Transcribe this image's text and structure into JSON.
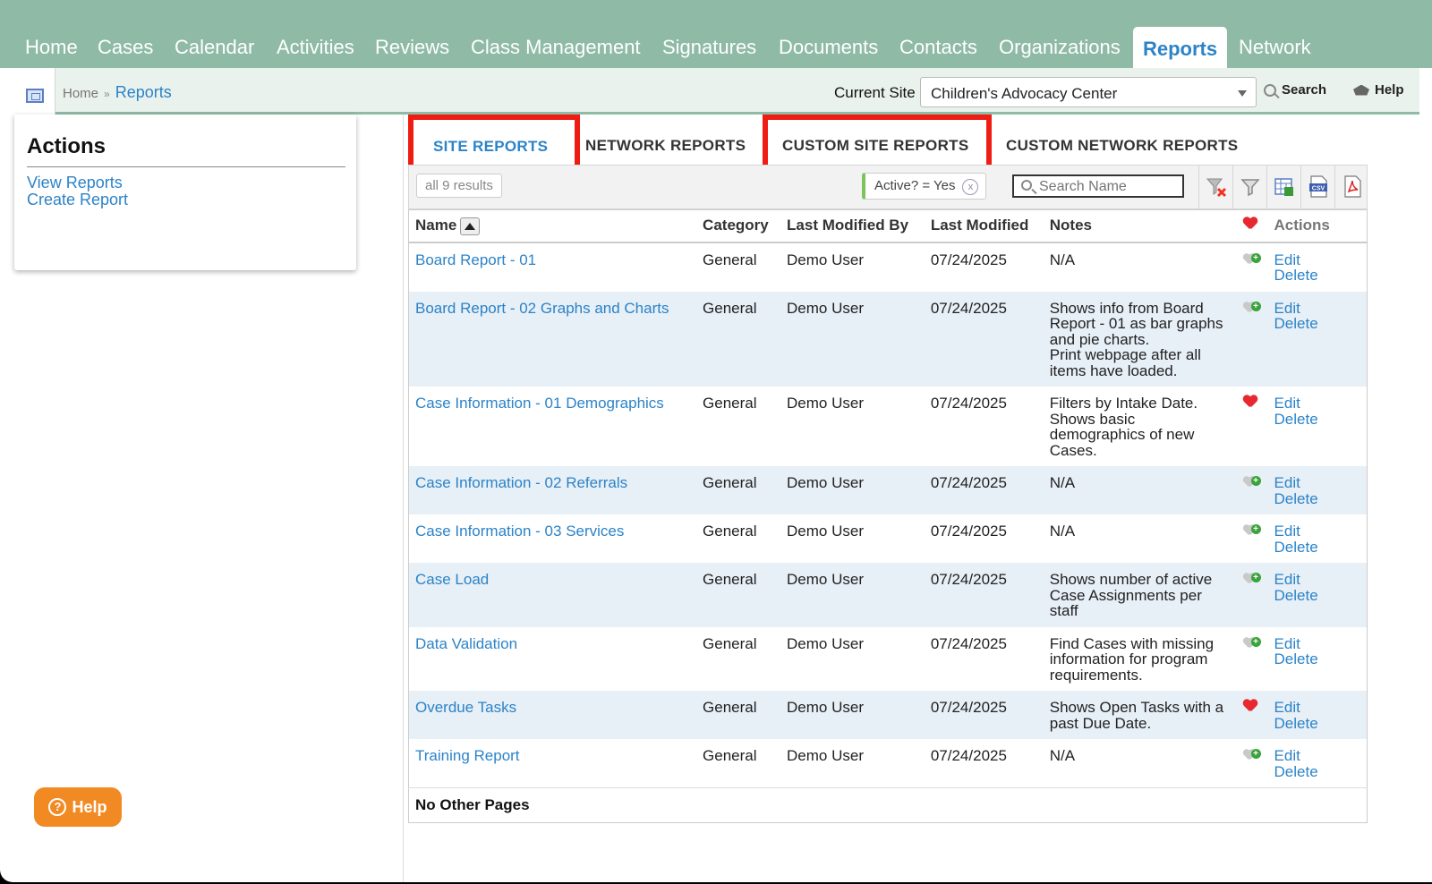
{
  "nav": {
    "items": [
      {
        "label": "Home"
      },
      {
        "label": "Cases"
      },
      {
        "label": "Calendar"
      },
      {
        "label": "Activities"
      },
      {
        "label": "Reviews"
      },
      {
        "label": "Class Management"
      },
      {
        "label": "Signatures"
      },
      {
        "label": "Documents"
      },
      {
        "label": "Contacts"
      },
      {
        "label": "Organizations"
      },
      {
        "label": "Reports",
        "active": true
      },
      {
        "label": "Network"
      }
    ]
  },
  "breadcrumb": {
    "home": "Home",
    "separator": "»",
    "current": "Reports"
  },
  "site": {
    "label": "Current Site",
    "value": "Children's Advocacy Center"
  },
  "tools": {
    "search": "Search",
    "help": "Help"
  },
  "actions": {
    "title": "Actions",
    "links": [
      "View Reports",
      "Create Report"
    ]
  },
  "tabs": [
    {
      "label": "SITE REPORTS",
      "active": true,
      "highlighted": true
    },
    {
      "label": "NETWORK REPORTS"
    },
    {
      "label": "CUSTOM SITE REPORTS",
      "highlighted": true
    },
    {
      "label": "CUSTOM NETWORK REPORTS"
    }
  ],
  "toolbar": {
    "results": "all 9 results",
    "filter": "Active? = Yes",
    "filter_clear": "x",
    "search_placeholder": "Search Name",
    "icons": [
      "clear-filters-icon",
      "filter-icon",
      "excel-export-icon",
      "csv-export-icon",
      "pdf-export-icon"
    ]
  },
  "table": {
    "headers": {
      "name": "Name",
      "category": "Category",
      "modified_by": "Last Modified By",
      "modified": "Last Modified",
      "notes": "Notes",
      "favorite": "favorite-heart-icon",
      "actions": "Actions"
    },
    "rows": [
      {
        "name": "Board Report - 01",
        "category": "General",
        "modified_by": "Demo User",
        "modified": "07/24/2025",
        "notes": [
          "N/A"
        ],
        "favorite": false
      },
      {
        "name": "Board Report - 02 Graphs and Charts",
        "category": "General",
        "modified_by": "Demo User",
        "modified": "07/24/2025",
        "notes": [
          "Shows info from Board",
          "Report - 01 as bar graphs",
          "and pie charts.",
          "Print webpage after all",
          "items have loaded."
        ],
        "favorite": false
      },
      {
        "name": "Case Information - 01 Demographics",
        "category": "General",
        "modified_by": "Demo User",
        "modified": "07/24/2025",
        "notes": [
          "Filters by Intake Date.",
          "Shows basic",
          "demographics of new",
          "Cases."
        ],
        "favorite": true
      },
      {
        "name": "Case Information - 02 Referrals",
        "category": "General",
        "modified_by": "Demo User",
        "modified": "07/24/2025",
        "notes": [
          "N/A"
        ],
        "favorite": false
      },
      {
        "name": "Case Information - 03 Services",
        "category": "General",
        "modified_by": "Demo User",
        "modified": "07/24/2025",
        "notes": [
          "N/A"
        ],
        "favorite": false
      },
      {
        "name": "Case Load",
        "category": "General",
        "modified_by": "Demo User",
        "modified": "07/24/2025",
        "notes": [
          "Shows number of active",
          "Case Assignments per",
          "staff"
        ],
        "favorite": false
      },
      {
        "name": "Data Validation",
        "category": "General",
        "modified_by": "Demo User",
        "modified": "07/24/2025",
        "notes": [
          "Find Cases with missing",
          "information for program",
          "requirements."
        ],
        "favorite": false
      },
      {
        "name": "Overdue Tasks",
        "category": "General",
        "modified_by": "Demo User",
        "modified": "07/24/2025",
        "notes": [
          "Shows Open Tasks with a",
          "past Due Date."
        ],
        "favorite": true
      },
      {
        "name": "Training Report",
        "category": "General",
        "modified_by": "Demo User",
        "modified": "07/24/2025",
        "notes": [
          "N/A"
        ],
        "favorite": false
      }
    ],
    "row_actions": {
      "edit": "Edit",
      "delete": "Delete"
    },
    "footer": "No Other Pages"
  },
  "help_button": "Help",
  "colors": {
    "nav_bg": "#8fbba6",
    "link": "#2c83c7",
    "highlight": "#ee1c12",
    "row_alt": "#e7eff7",
    "help_bg": "#f28a23"
  }
}
